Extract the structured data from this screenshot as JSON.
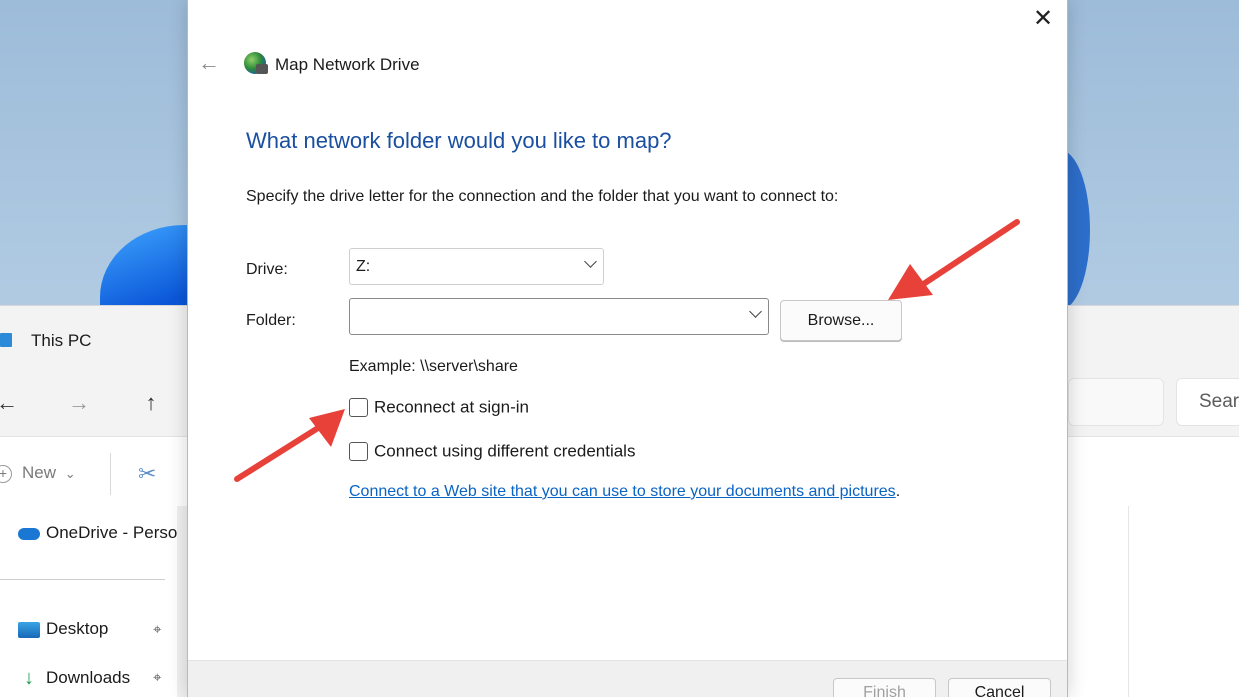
{
  "explorer": {
    "title": "This PC",
    "nav": {
      "back": "←",
      "forward": "→",
      "up": "↑"
    },
    "toolbar": {
      "new_label": "New",
      "new_chevron": "⌄",
      "cut_glyph": "✂"
    },
    "search_placeholder": "Sear",
    "sidebar": {
      "onedrive": "OneDrive - Perso",
      "desktop": "Desktop",
      "downloads": "Downloads",
      "pin_glyph": "📌"
    }
  },
  "dialog": {
    "title": "Map Network Drive",
    "close_glyph": "✕",
    "back_glyph": "←",
    "heading": "What network folder would you like to map?",
    "instructions": "Specify the drive letter for the connection and the folder that you want to connect to:",
    "drive_label": "Drive:",
    "drive_value": "Z:",
    "folder_label": "Folder:",
    "folder_value": "",
    "browse_label": "Browse...",
    "example": "Example: \\\\server\\share",
    "reconnect_label": "Reconnect at sign-in",
    "reconnect_checked": false,
    "credentials_label": "Connect using different credentials",
    "credentials_checked": false,
    "link_text": "Connect to a Web site that you can use to store your documents and pictures",
    "link_suffix": ".",
    "finish_label": "Finish",
    "cancel_label": "Cancel"
  },
  "colors": {
    "heading": "#1a4fa0",
    "link": "#0a64c4",
    "arrow": "#e8413a"
  },
  "icons": [
    "pc-icon",
    "back-arrow-icon",
    "forward-arrow-icon",
    "up-arrow-icon",
    "add-icon",
    "cut-icon",
    "onedrive-icon",
    "desktop-icon",
    "download-icon",
    "pin-icon",
    "close-icon",
    "globe-network-icon",
    "chevron-down-icon"
  ]
}
